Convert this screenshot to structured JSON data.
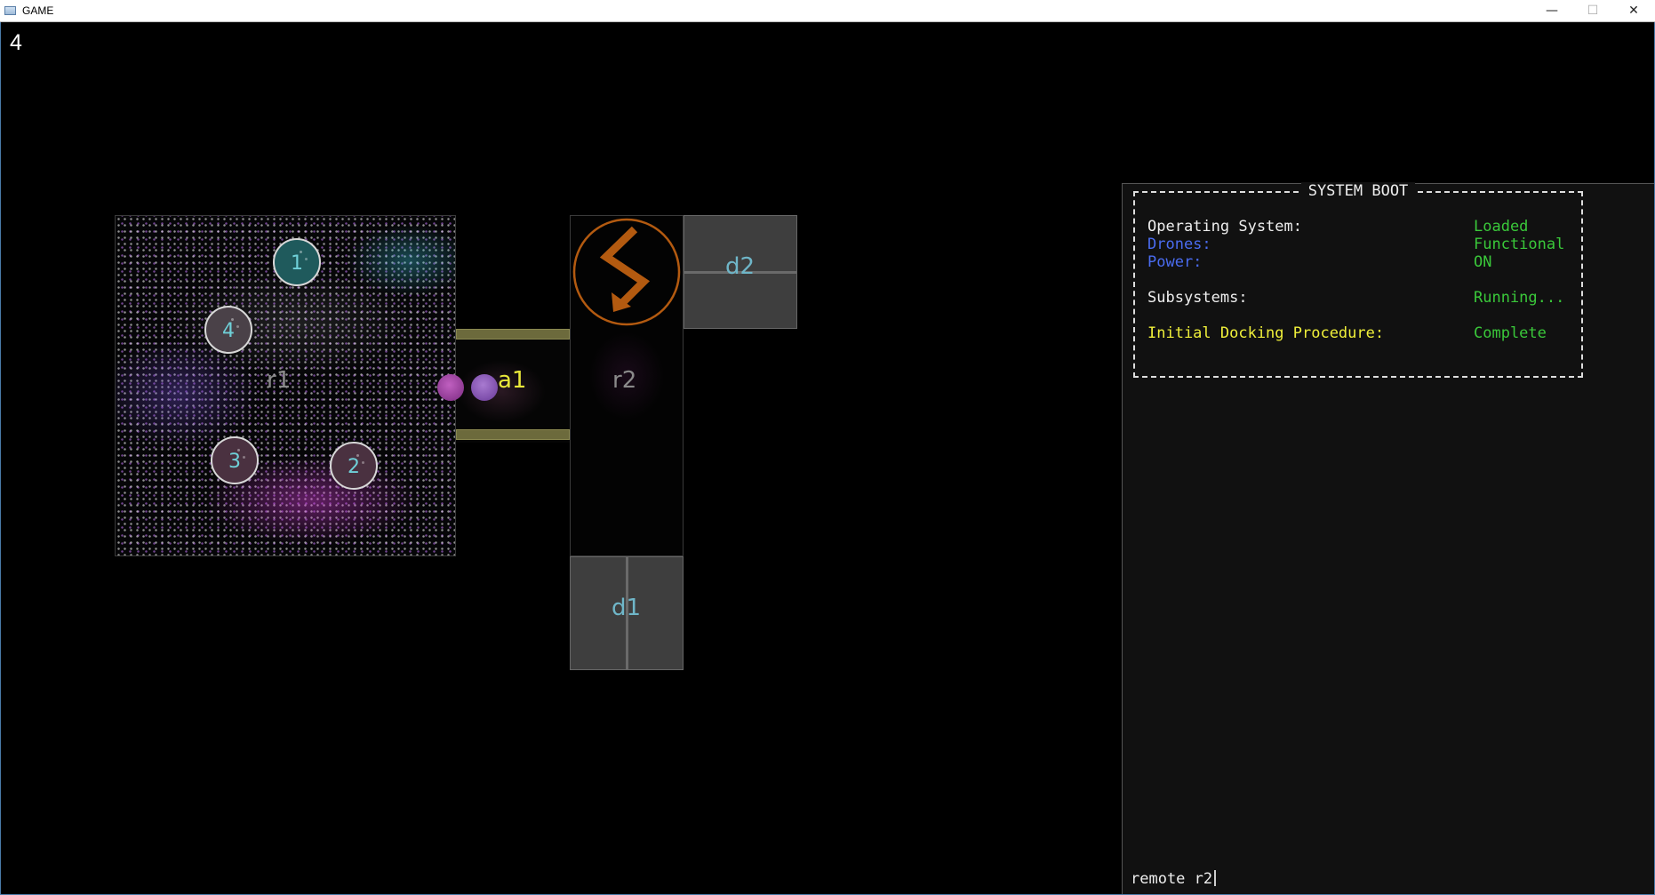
{
  "window": {
    "title": "GAME",
    "minimize": "—",
    "maximize": "☐",
    "close": "✕"
  },
  "counter": "4",
  "map": {
    "rooms": {
      "r1": "r1",
      "r2": "r2",
      "d1": "d1",
      "d2": "d2",
      "a1": "a1"
    },
    "drones": [
      "1",
      "2",
      "3",
      "4"
    ],
    "power_icon": "power-bolt-icon"
  },
  "terminal": {
    "title": "SYSTEM BOOT",
    "rows": [
      {
        "label": "Operating System:",
        "value": "Loaded"
      },
      {
        "label": "Drones:",
        "value": "Functional"
      },
      {
        "label": "Power:",
        "value": "ON"
      },
      {
        "label": "Subsystems:",
        "value": "Running..."
      },
      {
        "label": "Initial Docking Procedure:",
        "value": "Complete"
      }
    ],
    "input": "remote r2"
  },
  "colors": {
    "label_white": "#eeeeee",
    "label_blue": "#4a6cf0",
    "label_yellow": "#f0f03a",
    "value_green": "#3ac83a",
    "power_orange": "#b35a10",
    "airlock_yellow": "#e8e83a"
  }
}
